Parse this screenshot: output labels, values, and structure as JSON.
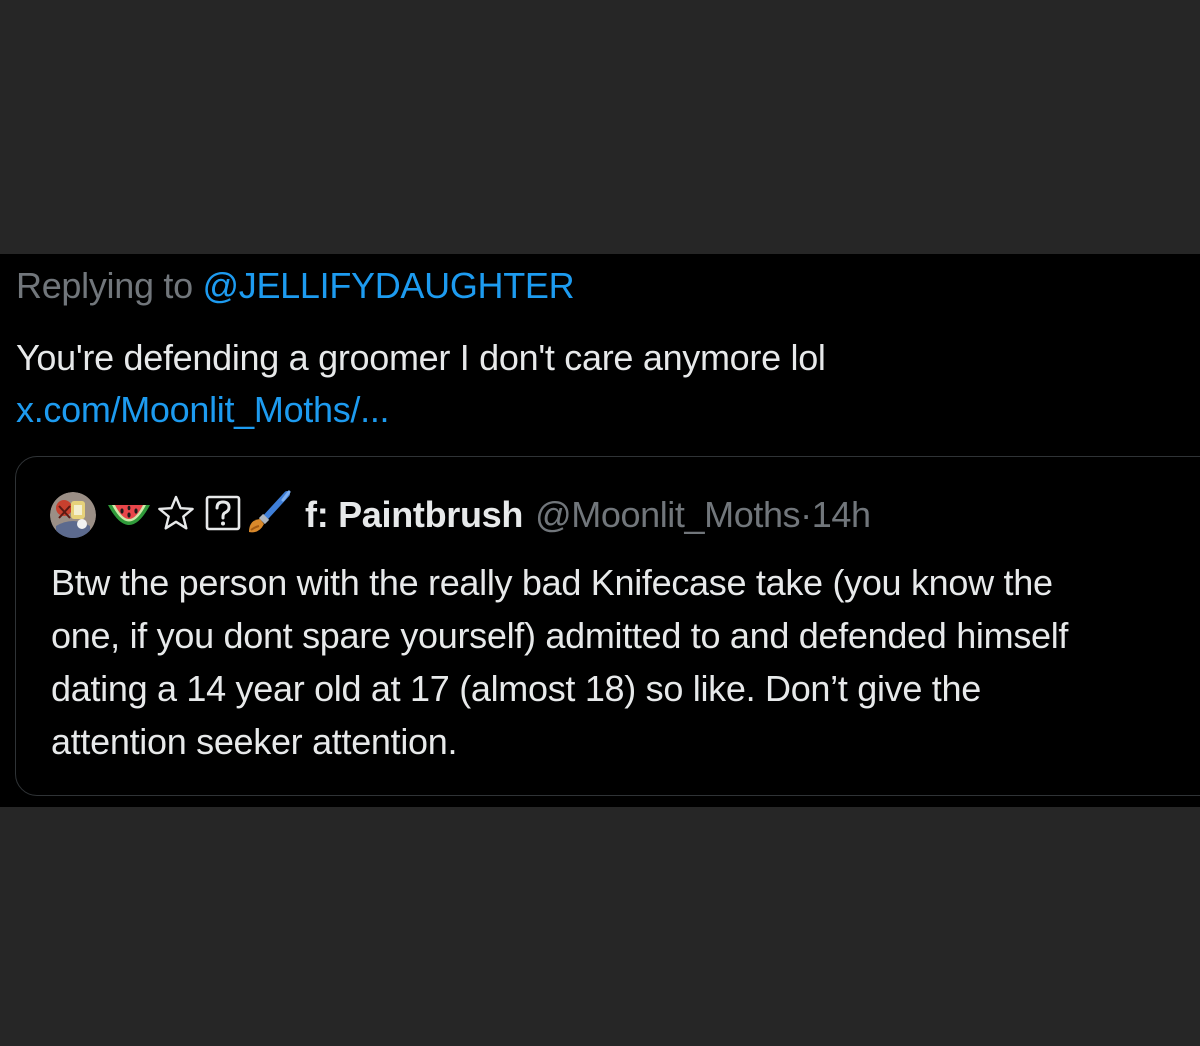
{
  "reply": {
    "replying_prefix": "Replying to",
    "replying_handle": "@JELLIFYDAUGHTER",
    "text": "You're defending a groomer I don't care anymore lol",
    "link": "x.com/Moonlit_Moths/..."
  },
  "quote": {
    "avatar_icon": "avatar-image",
    "name_emojis": [
      "watermelon-icon",
      "star-outline-icon",
      "question-box-icon",
      "paintbrush-icon"
    ],
    "display_name": "f: Paintbrush",
    "handle": "@Moonlit_Moths",
    "separator": "·",
    "time": "14h",
    "text_lines": [
      "Btw the person with the really bad Knifecase take (you know the",
      "one, if you dont spare yourself) admitted to and defended himself",
      "dating a 14 year old at 17 (almost 18) so like. Don’t give the",
      "attention seeker attention."
    ]
  },
  "colors": {
    "outer_background": "#262626",
    "tweet_background": "#000000",
    "primary_text": "#e7e9ea",
    "secondary_text": "#71767b",
    "link": "#1d9bf0",
    "card_border": "#2f3336"
  }
}
